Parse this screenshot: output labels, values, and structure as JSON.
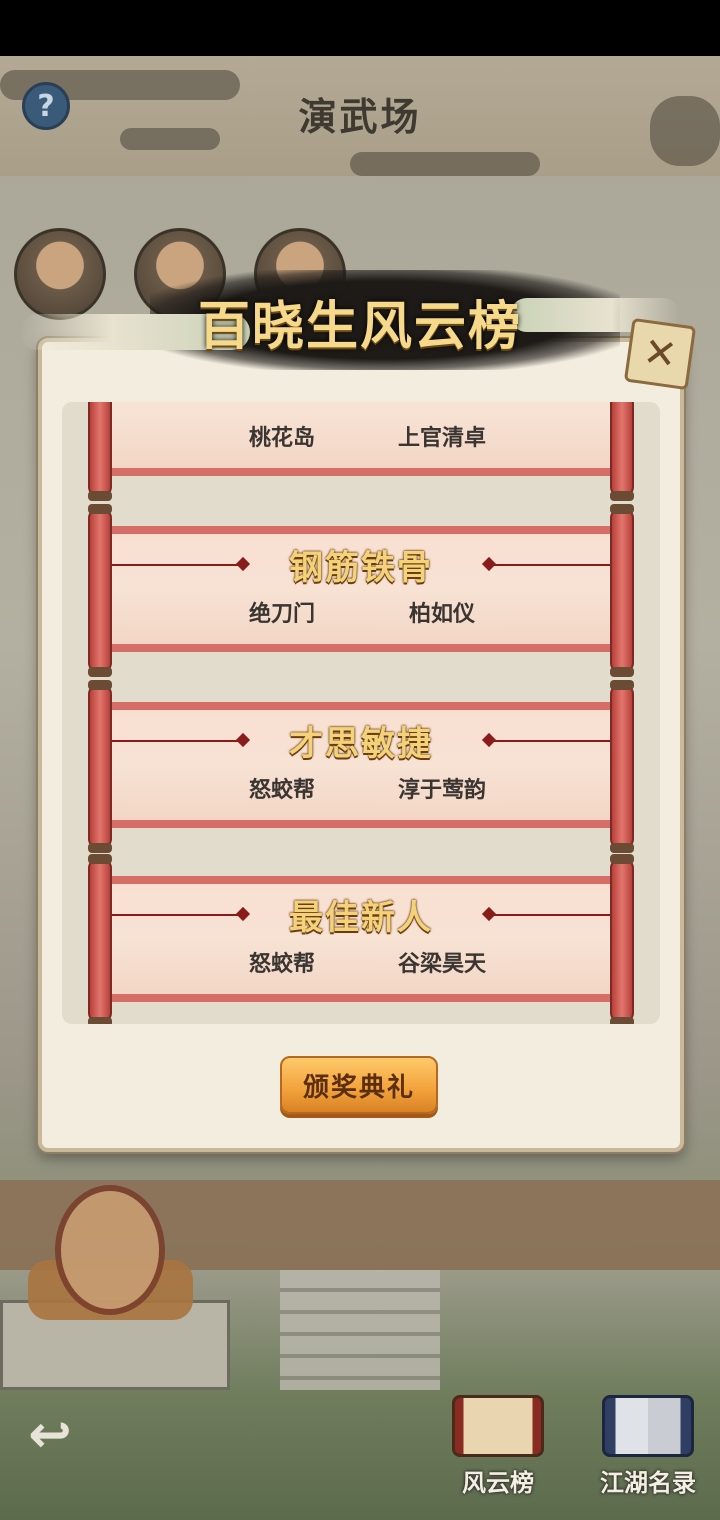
{
  "scene": {
    "title": "演武场",
    "help_icon": "?"
  },
  "popup": {
    "title": "百晓生风云榜",
    "close_icon": "✕",
    "awards": [
      {
        "title": "",
        "sect": "桃花岛",
        "person": "上官清卓"
      },
      {
        "title": "钢筋铁骨",
        "sect": "绝刀门",
        "person": "柏如仪"
      },
      {
        "title": "才思敏捷",
        "sect": "怒蛟帮",
        "person": "淳于莺韵"
      },
      {
        "title": "最佳新人",
        "sect": "怒蛟帮",
        "person": "谷梁昊天"
      }
    ],
    "ceremony_button": "颁奖典礼"
  },
  "bottom_nav": {
    "back_icon": "↩",
    "items": [
      {
        "label": "风云榜",
        "icon": "scroll-icon"
      },
      {
        "label": "江湖名录",
        "icon": "book-icon"
      }
    ]
  }
}
